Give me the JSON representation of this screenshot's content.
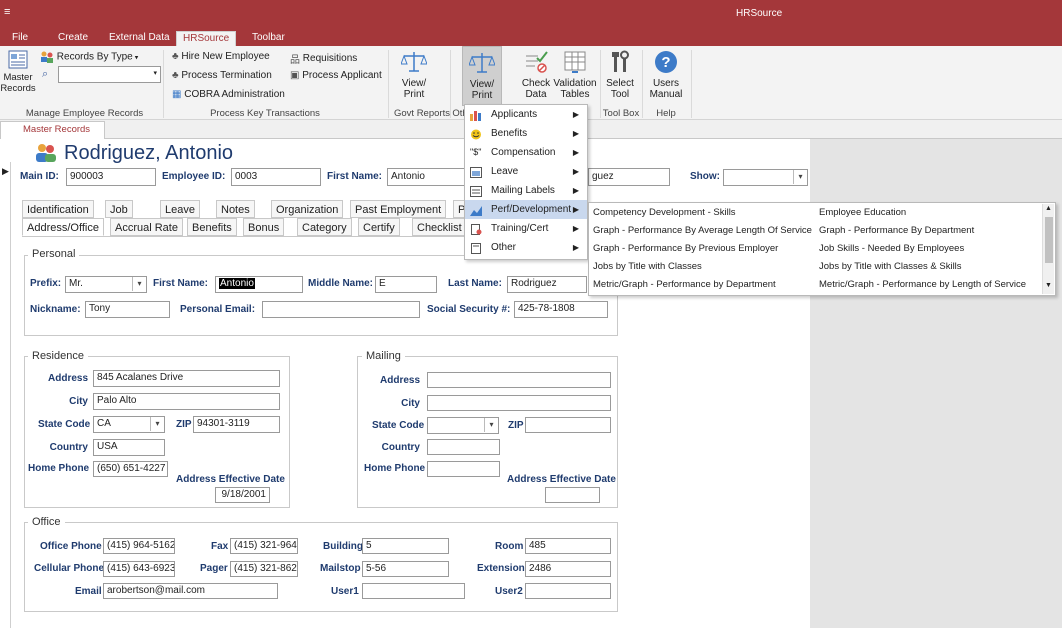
{
  "app": {
    "title": "HRSource",
    "qa_glyph": "≡"
  },
  "ribbon_tabs": [
    "File",
    "Create",
    "External Data",
    "HRSource",
    "Toolbar"
  ],
  "ribbon": {
    "master_records": "Master Records",
    "records_by_type": "Records By Type",
    "hire_new_employee": "Hire New Employee",
    "process_termination": "Process Termination",
    "cobra_administration": "COBRA Administration",
    "requisitions": "Requisitions",
    "process_applicant": "Process Applicant",
    "view_print_1": "View/ Print",
    "view_print_2": "View/ Print",
    "check_data": "Check Data",
    "validation_tables": "Validation Tables",
    "select_tool": "Select Tool",
    "users_manual": "Users Manual",
    "groups": {
      "manage": "Manage Employee Records",
      "process": "Process Key Transactions",
      "govt": "Govt Reports",
      "oth": "Oth",
      "toolbox": "Tool Box",
      "help": "Help"
    }
  },
  "doc_tab": "Master Records",
  "employee": {
    "full_name": "Rodriguez, Antonio",
    "main_id_label": "Main ID:",
    "main_id": "900003",
    "employee_id_label": "Employee ID:",
    "employee_id": "0003",
    "first_name_label": "First Name:",
    "first_name": "Antonio",
    "last_name_partial": "guez",
    "show_label": "Show:"
  },
  "form_tabs_row1": [
    "Identification",
    "Job",
    "Leave",
    "Notes",
    "Organization",
    "Past Employment",
    "P"
  ],
  "form_tabs_row2": [
    "Address/Office",
    "Accrual Rate",
    "Benefits",
    "Bonus",
    "Category",
    "Certify",
    "Checklist"
  ],
  "personal": {
    "title": "Personal",
    "prefix_label": "Prefix:",
    "prefix": "Mr.",
    "first_name_label": "First Name:",
    "first_name": "Antonio",
    "middle_name_label": "Middle Name:",
    "middle_name": "E",
    "last_name_label": "Last Name:",
    "last_name": "Rodriguez",
    "nickname_label": "Nickname:",
    "nickname": "Tony",
    "email_label": "Personal Email:",
    "email": "",
    "ssn_label": "Social Security #:",
    "ssn": "425-78-1808"
  },
  "residence": {
    "title": "Residence",
    "address_label": "Address",
    "address": "845 Acalanes Drive",
    "city_label": "City",
    "city": "Palo Alto",
    "state_label": "State Code",
    "state": "CA",
    "zip_label": "ZIP",
    "zip": "94301-3119",
    "country_label": "Country",
    "country": "USA",
    "phone_label": "Home Phone",
    "phone": "(650) 651-4227",
    "eff_label": "Address Effective Date",
    "eff_date": "9/18/2001"
  },
  "mailing": {
    "title": "Mailing",
    "address_label": "Address",
    "city_label": "City",
    "state_label": "State Code",
    "zip_label": "ZIP",
    "country_label": "Country",
    "phone_label": "Home Phone",
    "eff_label": "Address Effective Date"
  },
  "office": {
    "title": "Office",
    "office_phone_label": "Office Phone",
    "office_phone": "(415) 964-5162",
    "fax_label": "Fax",
    "fax": "(415) 321-964",
    "building_label": "Building",
    "building": "5",
    "room_label": "Room",
    "room": "485",
    "cell_label": "Cellular Phone",
    "cell": "(415) 643-6923",
    "pager_label": "Pager",
    "pager": "(415) 321-862",
    "mailstop_label": "Mailstop",
    "mailstop": "5-56",
    "extension_label": "Extension",
    "extension": "2486",
    "email_label": "Email",
    "email": "arobertson@mail.com",
    "user1_label": "User1",
    "user2_label": "User2"
  },
  "menu": [
    {
      "label": "Applicants",
      "icon": "people-icon"
    },
    {
      "label": "Benefits",
      "icon": "smiley-icon"
    },
    {
      "label": "Compensation",
      "icon": "dollar-icon"
    },
    {
      "label": "Leave",
      "icon": "calendar-icon"
    },
    {
      "label": "Mailing Labels",
      "icon": "label-icon"
    },
    {
      "label": "Perf/Development",
      "icon": "chart-icon"
    },
    {
      "label": "Training/Cert",
      "icon": "certificate-icon"
    },
    {
      "label": "Other",
      "icon": "document-icon"
    }
  ],
  "submenu_col1": [
    "Competency Development - Skills",
    "Graph - Performance By Average Length Of Service",
    "Graph - Performance By Previous Employer",
    "Jobs by Title with Classes",
    "Metric/Graph - Performance by Department"
  ],
  "submenu_col2": [
    "Employee Education",
    "Graph - Performance By Department",
    "Job Skills - Needed By Employees",
    "Jobs by Title with Classes & Skills",
    "Metric/Graph - Performance by Length of Service"
  ],
  "colors": {
    "brand": "#a4373a",
    "label": "#1f3b6e",
    "highlight": "#c9d8ee"
  }
}
